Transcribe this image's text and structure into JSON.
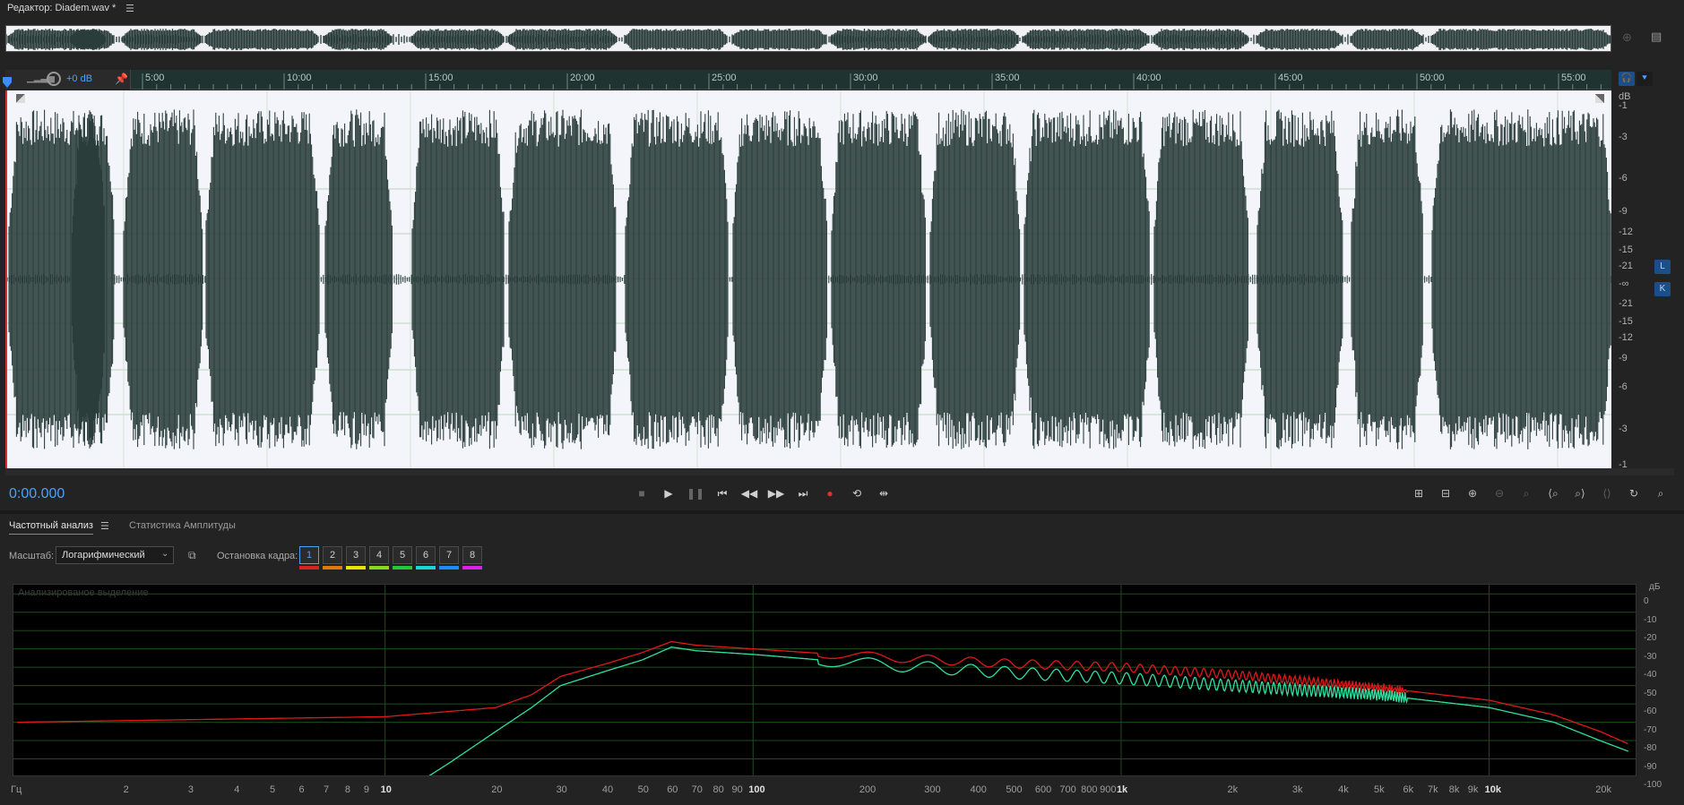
{
  "editor": {
    "title": "Редактор: Diadem.wav *",
    "menu_icon": "hamburger-menu-icon"
  },
  "hud": {
    "gain": "+0 dB"
  },
  "ruler": {
    "labels": [
      "5:00",
      "10:00",
      "15:00",
      "20:00",
      "25:00",
      "30:00",
      "35:00",
      "40:00",
      "45:00",
      "50:00",
      "55:00"
    ]
  },
  "db_scale": {
    "unit": "dB",
    "labels": [
      "-1",
      "-3",
      "-6",
      "-9",
      "-12",
      "-15",
      "-21",
      "-∞",
      "-21",
      "-15",
      "-12",
      "-9",
      "-6",
      "-3",
      "-1"
    ]
  },
  "channels": {
    "left": "L",
    "right": "K"
  },
  "transport": {
    "time": "0:00.000"
  },
  "tabs": {
    "frequency": "Частотный анализ",
    "amplitude": "Статистика Амплитуды"
  },
  "controls": {
    "scale_label": "Масштаб:",
    "scale_value": "Логарифмический",
    "freeze_label": "Остановка кадра:",
    "frames": [
      "1",
      "2",
      "3",
      "4",
      "5",
      "6",
      "7",
      "8"
    ],
    "frame_colors": [
      "#d8241c",
      "#e07a10",
      "#e6e600",
      "#8ed81c",
      "#1ecb39",
      "#15d8d8",
      "#1c8cff",
      "#e020e0"
    ]
  },
  "spectrum": {
    "caption": "Анализированое выделение",
    "db_unit": "дБ",
    "db_labels": [
      "0",
      "-10",
      "-20",
      "-30",
      "-40",
      "-50",
      "-60",
      "-70",
      "-80",
      "-90",
      "-100"
    ],
    "freq_unit": "Гц",
    "freq_labels": [
      "2",
      "3",
      "4",
      "5",
      "6",
      "7",
      "8",
      "9",
      "10",
      "20",
      "30",
      "40",
      "50",
      "60",
      "70",
      "80",
      "90",
      "100",
      "200",
      "300",
      "400",
      "500",
      "600",
      "700",
      "800",
      "900",
      "1k",
      "2k",
      "3k",
      "4k",
      "5k",
      "6k",
      "7k",
      "8k",
      "9k",
      "10k",
      "20k"
    ],
    "freq_bold": [
      "10",
      "100",
      "1k",
      "10k"
    ]
  },
  "colors": {
    "accent": "#4aa0ff",
    "waveform": "#2a3d3b",
    "waveform_bg": "#f4f4fb",
    "spectrum_left": "#e01818",
    "spectrum_right": "#30e0a0"
  },
  "chart_data": {
    "type": "line",
    "x_scale": "log",
    "xlim": [
      1,
      25000
    ],
    "ylim": [
      -100,
      5
    ],
    "series": [
      {
        "color": "#e01818",
        "points": [
          [
            1,
            -70
          ],
          [
            10,
            -67
          ],
          [
            20,
            -62
          ],
          [
            25,
            -55
          ],
          [
            30,
            -45
          ],
          [
            40,
            -38
          ],
          [
            50,
            -32
          ],
          [
            60,
            -26
          ],
          [
            70,
            -28
          ],
          [
            100,
            -30
          ],
          [
            200,
            -34
          ],
          [
            500,
            -38
          ],
          [
            1000,
            -40
          ],
          [
            2000,
            -44
          ],
          [
            5000,
            -51
          ],
          [
            10000,
            -58
          ],
          [
            15000,
            -66
          ],
          [
            20000,
            -75
          ],
          [
            24000,
            -82
          ]
        ]
      },
      {
        "color": "#30e0a0",
        "points": [
          [
            13,
            -100
          ],
          [
            15,
            -92
          ],
          [
            20,
            -75
          ],
          [
            25,
            -62
          ],
          [
            30,
            -50
          ],
          [
            40,
            -42
          ],
          [
            50,
            -36
          ],
          [
            60,
            -29
          ],
          [
            70,
            -31
          ],
          [
            100,
            -33
          ],
          [
            200,
            -38
          ],
          [
            500,
            -43
          ],
          [
            1000,
            -46
          ],
          [
            2000,
            -50
          ],
          [
            5000,
            -55
          ],
          [
            10000,
            -62
          ],
          [
            15000,
            -70
          ],
          [
            20000,
            -80
          ],
          [
            24000,
            -86
          ]
        ]
      }
    ]
  }
}
